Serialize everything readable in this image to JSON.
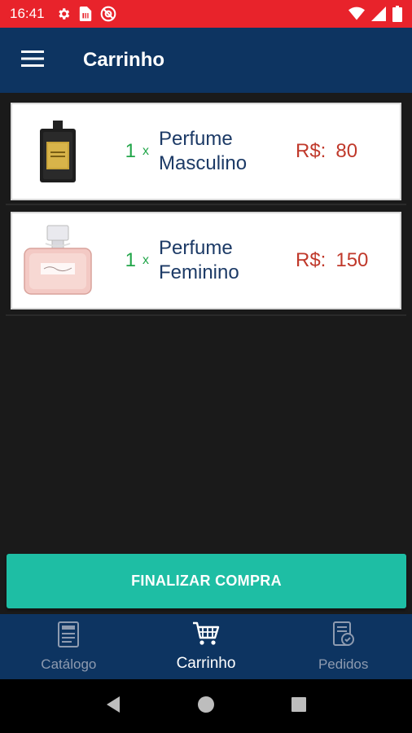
{
  "status_bar": {
    "time": "16:41",
    "left_icons": [
      "gear-icon",
      "sim-card-icon",
      "no-disturb-icon"
    ],
    "right_icons": [
      "wifi-icon",
      "signal-icon",
      "battery-icon"
    ]
  },
  "app_bar": {
    "title": "Carrinho",
    "menu_icon": "hamburger-menu-icon"
  },
  "cart": {
    "items": [
      {
        "quantity": "1",
        "times": "x",
        "name": "Perfume Masculino",
        "currency": "R$:",
        "price": "80",
        "image": "perfume-masculino-image"
      },
      {
        "quantity": "1",
        "times": "x",
        "name": "Perfume Feminino",
        "currency": "R$:",
        "price": "150",
        "image": "perfume-feminino-image"
      }
    ]
  },
  "checkout": {
    "label": "FINALIZAR COMPRA"
  },
  "bottom_nav": {
    "items": [
      {
        "label": "Catálogo",
        "icon": "catalog-icon",
        "active": false
      },
      {
        "label": "Carrinho",
        "icon": "cart-icon",
        "active": true
      },
      {
        "label": "Pedidos",
        "icon": "orders-icon",
        "active": false
      }
    ]
  },
  "colors": {
    "status_bar": "#e8232b",
    "app_bar": "#0d3461",
    "checkout": "#1ebea4",
    "quantity": "#22a64a",
    "price": "#c0392b",
    "name": "#1c3a66"
  }
}
